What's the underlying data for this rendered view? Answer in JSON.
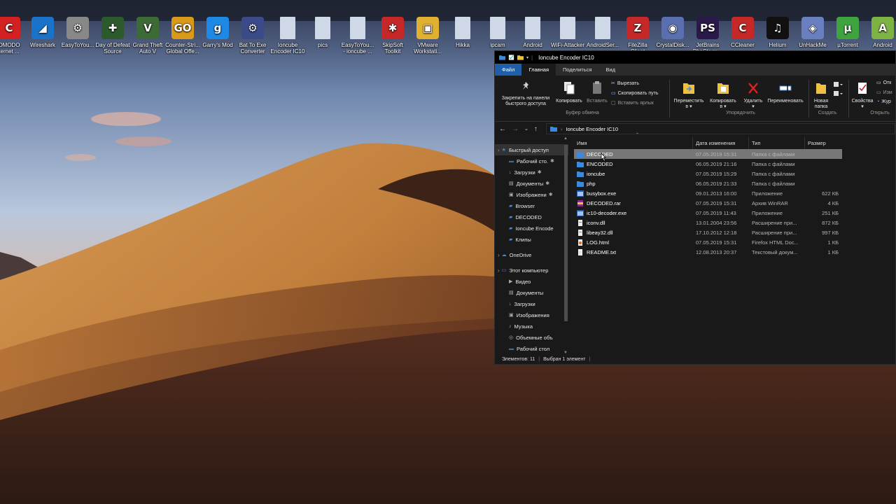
{
  "desktop": {
    "icons": [
      {
        "label": "OMODO\nternet ...",
        "icon": "comodo-icon",
        "color": "#d32020",
        "glyph": "C"
      },
      {
        "label": "Wireshark",
        "icon": "wireshark-icon",
        "color": "#1a73c9",
        "glyph": "◢"
      },
      {
        "label": "EasyToYou...",
        "icon": "gear-icon",
        "color": "#888888",
        "glyph": "⚙"
      },
      {
        "label": "Day of Defeat\nSource",
        "icon": "day-of-defeat-icon",
        "color": "#2d5a2d",
        "glyph": "✚"
      },
      {
        "label": "Grand Theft\nAuto V",
        "icon": "gta-icon",
        "color": "#3d6b35",
        "glyph": "V"
      },
      {
        "label": "Counter-Stri...\nGlobal Offe...",
        "icon": "csgo-icon",
        "color": "#d99a1a",
        "glyph": "GO"
      },
      {
        "label": "Garry's Mod",
        "icon": "garrys-mod-icon",
        "color": "#1e88e5",
        "glyph": "g"
      },
      {
        "label": "Bat To Exe\nConverter",
        "icon": "bat-to-exe-icon",
        "color": "#3b4b8a",
        "glyph": "⚙"
      },
      {
        "label": "Ioncube\nEncoder IC10",
        "icon": "file-icon",
        "color": "#cfd8e6",
        "glyph": ""
      },
      {
        "label": "pics",
        "icon": "file-icon",
        "color": "#cfd8e6",
        "glyph": ""
      },
      {
        "label": "EasyToYou...\n- ioncube ...",
        "icon": "file-icon",
        "color": "#cfd8e6",
        "glyph": ""
      },
      {
        "label": "SkipSoft\nToolkit",
        "icon": "skipsoft-icon",
        "color": "#c62828",
        "glyph": "✱"
      },
      {
        "label": "VMware\nWorkstati...",
        "icon": "vmware-icon",
        "color": "#e0b030",
        "glyph": "▣"
      },
      {
        "label": "Hikka",
        "icon": "file-icon",
        "color": "#cfd8e6",
        "glyph": ""
      },
      {
        "label": "ipcam",
        "icon": "file-icon",
        "color": "#cfd8e6",
        "glyph": ""
      },
      {
        "label": "Android",
        "icon": "file-icon",
        "color": "#cfd8e6",
        "glyph": ""
      },
      {
        "label": "WiFi-Attacker",
        "icon": "file-icon",
        "color": "#cfd8e6",
        "glyph": ""
      },
      {
        "label": "AndroidSer...",
        "icon": "file-icon",
        "color": "#cfd8e6",
        "glyph": ""
      },
      {
        "label": "FileZilla\nClient",
        "icon": "filezilla-icon",
        "color": "#c62828",
        "glyph": "Z"
      },
      {
        "label": "CrystalDisk...",
        "icon": "crystaldisk-icon",
        "color": "#5a6fb0",
        "glyph": "◉"
      },
      {
        "label": "JetBrains\nPhpStorm...",
        "icon": "phpstorm-icon",
        "color": "#2a1a4a",
        "glyph": "PS"
      },
      {
        "label": "CCleaner",
        "icon": "ccleaner-icon",
        "color": "#c62828",
        "glyph": "C"
      },
      {
        "label": "Helium",
        "icon": "helium-icon",
        "color": "#111111",
        "glyph": "♫"
      },
      {
        "label": "UnHackMe",
        "icon": "unhackme-icon",
        "color": "#6a7fc0",
        "glyph": "◈"
      },
      {
        "label": "µTorrent",
        "icon": "utorrent-icon",
        "color": "#3fa33f",
        "glyph": "µ"
      },
      {
        "label": "Android",
        "icon": "android-icon",
        "color": "#7cb342",
        "glyph": "A"
      }
    ]
  },
  "window": {
    "title": "Ioncube Encoder IC10",
    "tabs": [
      "Файл",
      "Главная",
      "Поделиться",
      "Вид"
    ],
    "ribbon": {
      "pin": "Закрепить на панели\nбыстрого доступа",
      "copy": "Копировать",
      "paste": "Вставить",
      "cut": "Вырезать",
      "copy_path": "Скопировать путь",
      "paste_shortcut": "Вставить ярлык",
      "group_clipboard": "Буфер обмена",
      "move_to": "Переместить\nв ▾",
      "copy_to": "Копировать\nв ▾",
      "delete": "Удалить\n▾",
      "rename": "Переименовать",
      "group_organize": "Упорядочить",
      "new_folder": "Новая\nпапка",
      "group_create": "Создать",
      "properties": "Свойства\n▾",
      "open_partial": "Отк",
      "edit_partial": "Изм",
      "history_partial": "Жур",
      "group_open": "Открыть"
    },
    "address": {
      "path": "Ioncube Encoder IC10"
    },
    "columns": {
      "name": "Имя",
      "date": "Дата изменения",
      "type": "Тип",
      "size": "Размер"
    },
    "navpane": [
      {
        "label": "Быстрый доступ",
        "level": 0,
        "icon": "star-icon",
        "pinned": false,
        "selected": true
      },
      {
        "label": "Рабочий сто.",
        "level": 1,
        "icon": "desktop-icon",
        "pinned": true
      },
      {
        "label": "Загрузки",
        "level": 1,
        "icon": "download-icon",
        "pinned": true
      },
      {
        "label": "Документы",
        "level": 1,
        "icon": "documents-icon",
        "pinned": true
      },
      {
        "label": "Изображени",
        "level": 1,
        "icon": "pictures-icon",
        "pinned": true
      },
      {
        "label": "Browser",
        "level": 1,
        "icon": "folder-icon",
        "pinned": false
      },
      {
        "label": "DECODED",
        "level": 1,
        "icon": "folder-icon",
        "pinned": false
      },
      {
        "label": "Ioncube Encode",
        "level": 1,
        "icon": "folder-icon",
        "pinned": false
      },
      {
        "label": "Клипы",
        "level": 1,
        "icon": "folder-icon",
        "pinned": false
      },
      {
        "label": "",
        "level": -1
      },
      {
        "label": "OneDrive",
        "level": 0,
        "icon": "onedrive-icon",
        "pinned": false
      },
      {
        "label": "",
        "level": -1
      },
      {
        "label": "Этот компьютер",
        "level": 0,
        "icon": "computer-icon",
        "pinned": false
      },
      {
        "label": "Видео",
        "level": 1,
        "icon": "video-icon",
        "pinned": false
      },
      {
        "label": "Документы",
        "level": 1,
        "icon": "documents-icon",
        "pinned": false
      },
      {
        "label": "Загрузки",
        "level": 1,
        "icon": "download-icon",
        "pinned": false
      },
      {
        "label": "Изображения",
        "level": 1,
        "icon": "pictures-icon",
        "pinned": false
      },
      {
        "label": "Музыка",
        "level": 1,
        "icon": "music-icon",
        "pinned": false
      },
      {
        "label": "Объемные объ",
        "level": 1,
        "icon": "3d-objects-icon",
        "pinned": false
      },
      {
        "label": "Рабочий стол",
        "level": 1,
        "icon": "desktop-icon",
        "pinned": false
      }
    ],
    "files": [
      {
        "name": "DECODED",
        "date": "07.05.2019 15:31",
        "type": "Папка с файлами",
        "size": "",
        "icon": "folder-icon",
        "selected": true
      },
      {
        "name": "ENCODED",
        "date": "06.05.2019 21:16",
        "type": "Папка с файлами",
        "size": "",
        "icon": "folder-icon"
      },
      {
        "name": "ioncube",
        "date": "07.05.2019 15:29",
        "type": "Папка с файлами",
        "size": "",
        "icon": "folder-icon"
      },
      {
        "name": "php",
        "date": "06.05.2019 21:33",
        "type": "Папка с файлами",
        "size": "",
        "icon": "folder-icon"
      },
      {
        "name": "busybox.exe",
        "date": "09.01.2013 16:00",
        "type": "Приложение",
        "size": "622 КБ",
        "icon": "exe-icon"
      },
      {
        "name": "DECODED.rar",
        "date": "07.05.2019 15:31",
        "type": "Архив WinRAR",
        "size": "4 КБ",
        "icon": "rar-icon"
      },
      {
        "name": "ic10-decoder.exe",
        "date": "07.05.2019 11:43",
        "type": "Приложение",
        "size": "251 КБ",
        "icon": "exe-icon"
      },
      {
        "name": "iconv.dll",
        "date": "13.01.2004 23:56",
        "type": "Расширение при...",
        "size": "872 КБ",
        "icon": "dll-icon"
      },
      {
        "name": "libeay32.dll",
        "date": "17.10.2012 12:18",
        "type": "Расширение при...",
        "size": "997 КБ",
        "icon": "dll-icon"
      },
      {
        "name": "LOG.html",
        "date": "07.05.2019 15:31",
        "type": "Firefox HTML Doc...",
        "size": "1 КБ",
        "icon": "html-icon"
      },
      {
        "name": "README.txt",
        "date": "12.08.2013 20:37",
        "type": "Текстовый докум...",
        "size": "1 КБ",
        "icon": "txt-icon"
      }
    ],
    "status": {
      "count": "Элементов: 11",
      "selected": "Выбран 1 элемент"
    }
  }
}
